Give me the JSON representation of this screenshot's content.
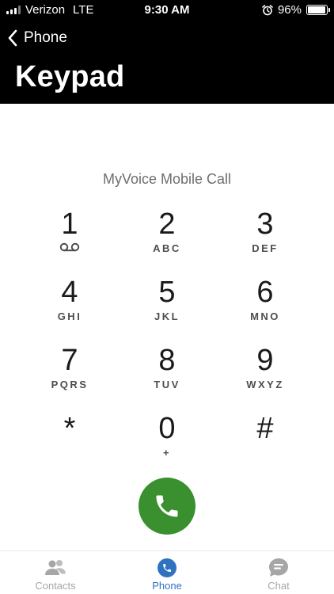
{
  "status_bar": {
    "carrier": "Verizon",
    "network": "LTE",
    "time": "9:30 AM",
    "battery": "96%",
    "battery_level": 0.96
  },
  "nav": {
    "back_label": "Phone",
    "title": "Keypad"
  },
  "keypad": {
    "line_label": "MyVoice Mobile Call",
    "keys": [
      {
        "digit": "1",
        "letters": ""
      },
      {
        "digit": "2",
        "letters": "ABC"
      },
      {
        "digit": "3",
        "letters": "DEF"
      },
      {
        "digit": "4",
        "letters": "GHI"
      },
      {
        "digit": "5",
        "letters": "JKL"
      },
      {
        "digit": "6",
        "letters": "MNO"
      },
      {
        "digit": "7",
        "letters": "PQRS"
      },
      {
        "digit": "8",
        "letters": "TUV"
      },
      {
        "digit": "9",
        "letters": "WXYZ"
      },
      {
        "digit": "*",
        "letters": ""
      },
      {
        "digit": "0",
        "letters": "+"
      },
      {
        "digit": "#",
        "letters": ""
      }
    ]
  },
  "tabs": [
    {
      "label": "Contacts",
      "icon": "contacts-icon",
      "active": false
    },
    {
      "label": "Phone",
      "icon": "phone-icon",
      "active": true
    },
    {
      "label": "Chat",
      "icon": "chat-icon",
      "active": false
    }
  ],
  "colors": {
    "header_bg": "#000000",
    "call_green": "#3a8f2f",
    "active_tab": "#2f72c0",
    "inactive_tab": "#a6a6a6"
  }
}
